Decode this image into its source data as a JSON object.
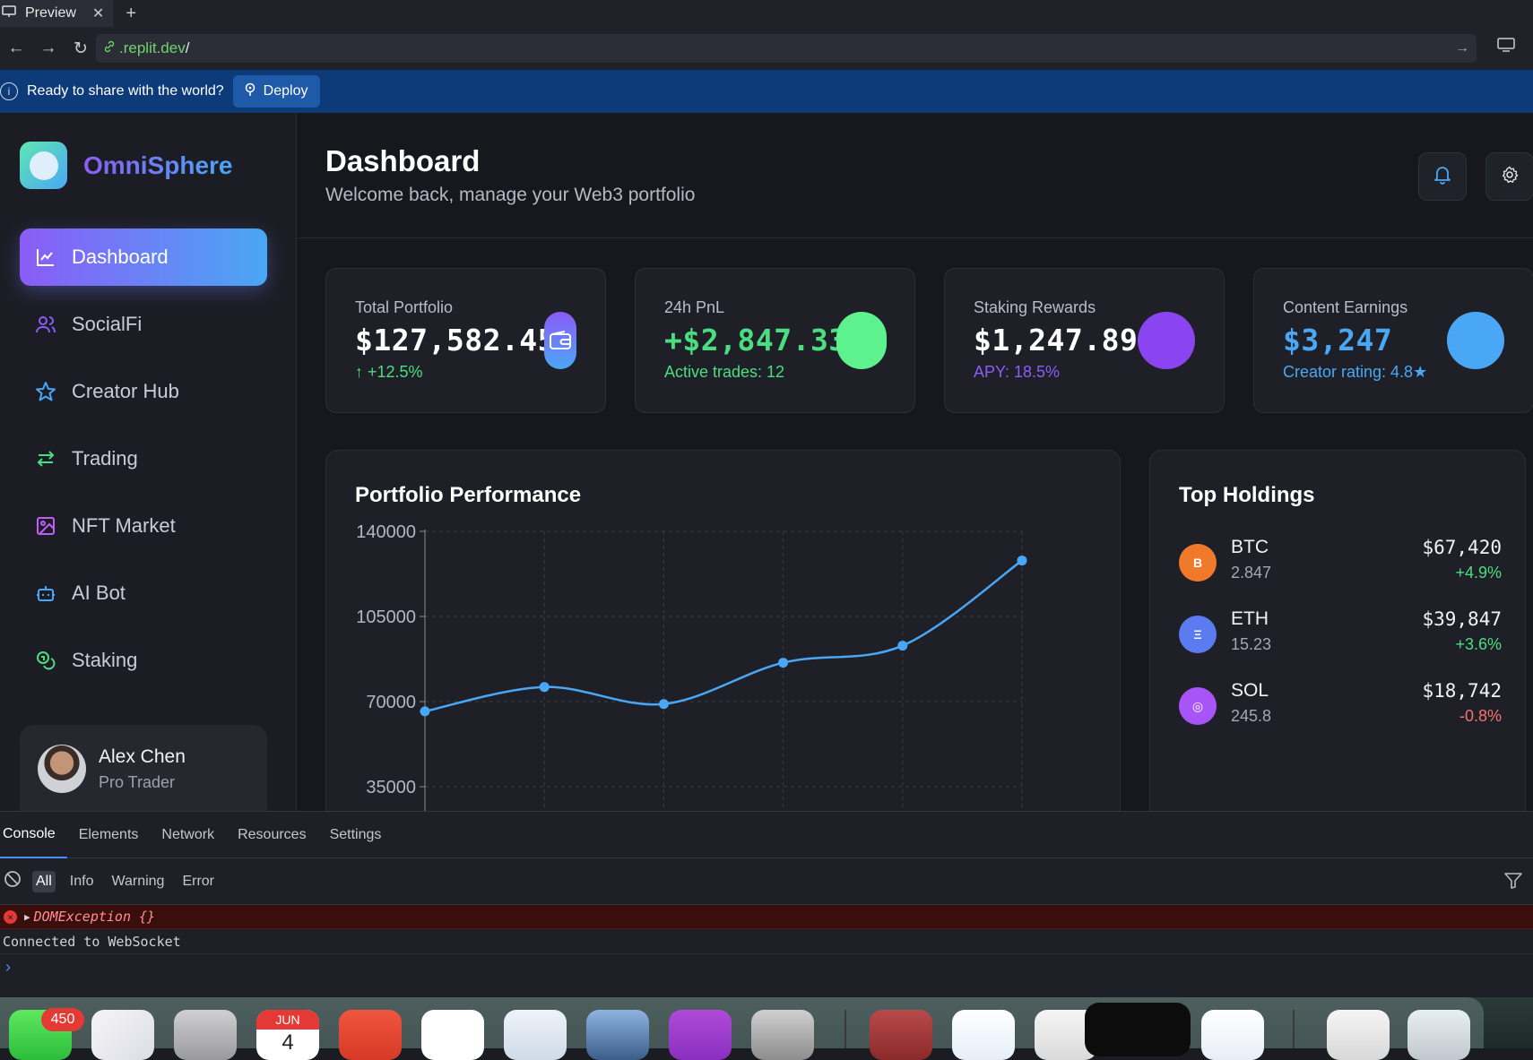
{
  "browser": {
    "tab_title": "Preview",
    "url_host": ".replit.dev",
    "url_path": "/"
  },
  "deploy_bar": {
    "message": "Ready to share with the world?",
    "button": "Deploy"
  },
  "sidebar": {
    "brand": "OmniSphere",
    "items": [
      {
        "label": "Dashboard",
        "icon": "chart-line-icon",
        "active": true
      },
      {
        "label": "SocialFi",
        "icon": "users-icon",
        "active": false
      },
      {
        "label": "Creator Hub",
        "icon": "star-icon",
        "active": false
      },
      {
        "label": "Trading",
        "icon": "arrows-swap-icon",
        "active": false
      },
      {
        "label": "NFT Market",
        "icon": "image-icon",
        "active": false
      },
      {
        "label": "AI Bot",
        "icon": "robot-icon",
        "active": false
      },
      {
        "label": "Staking",
        "icon": "coins-icon",
        "active": false
      }
    ],
    "user": {
      "name": "Alex Chen",
      "role": "Pro Trader"
    }
  },
  "header": {
    "title": "Dashboard",
    "subtitle": "Welcome back, manage your Web3 portfolio"
  },
  "stats": [
    {
      "label": "Total Portfolio",
      "value": "$127,582.45",
      "sub": "↑ +12.5%",
      "color": "#4ade80",
      "value_color": "#ffffff"
    },
    {
      "label": "24h PnL",
      "value": "+$2,847.33",
      "sub": "Active trades: 12",
      "color": "#4ade80",
      "value_color": "#4ade80"
    },
    {
      "label": "Staking Rewards",
      "value": "$1,247.89",
      "sub": "APY: 18.5%",
      "color": "#8b5cf6",
      "value_color": "#ffffff"
    },
    {
      "label": "Content Earnings",
      "value": "$3,247",
      "sub": "Creator rating: 4.8★",
      "color": "#4aa7f5",
      "value_color": "#4aa7f5"
    }
  ],
  "performance": {
    "title": "Portfolio Performance"
  },
  "chart_data": {
    "type": "line",
    "title": "Portfolio Performance",
    "x": [
      0,
      1,
      2,
      3,
      4,
      5
    ],
    "values": [
      66000,
      76000,
      69000,
      86000,
      93000,
      128000
    ],
    "ylim": [
      0,
      140000
    ],
    "yticks": [
      140000,
      105000,
      70000,
      35000
    ],
    "grid": true,
    "line_color": "#4aa7f5"
  },
  "holdings": {
    "title": "Top Holdings",
    "items": [
      {
        "symbol": "BTC",
        "glyph": "B",
        "amount": "2.847",
        "value": "$67,420",
        "change": "+4.9%",
        "change_color": "#4ade80",
        "coin_color": "#f07a2a"
      },
      {
        "symbol": "ETH",
        "glyph": "Ξ",
        "amount": "15.23",
        "value": "$39,847",
        "change": "+3.6%",
        "change_color": "#4ade80",
        "coin_color": "#5b7cf0"
      },
      {
        "symbol": "SOL",
        "glyph": "◎",
        "amount": "245.8",
        "value": "$18,742",
        "change": "-0.8%",
        "change_color": "#f87171",
        "coin_color": "#a855f7"
      }
    ]
  },
  "devtools": {
    "tabs": [
      "Console",
      "Elements",
      "Network",
      "Resources",
      "Settings"
    ],
    "levels": [
      "All",
      "Info",
      "Warning",
      "Error"
    ],
    "error": "DOMException {}",
    "log": "Connected to WebSocket"
  },
  "dock": {
    "badge": "450",
    "calendar_month": "JUN",
    "calendar_day": "4"
  }
}
